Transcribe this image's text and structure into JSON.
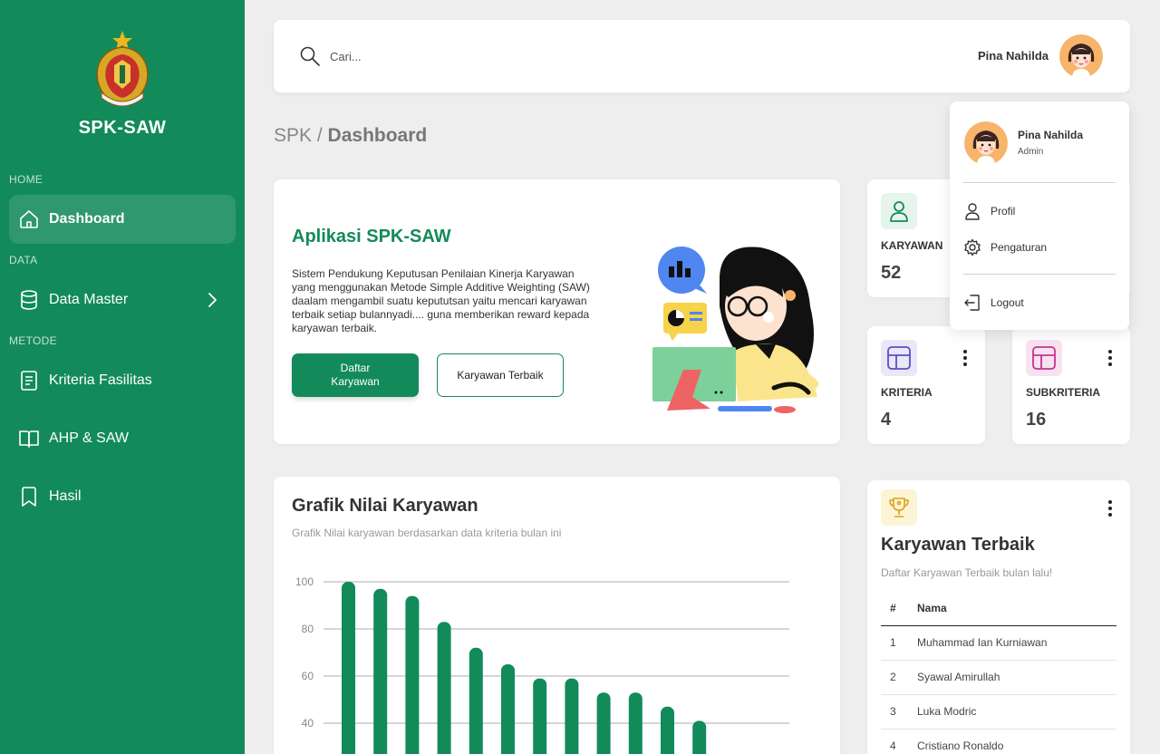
{
  "sidebar": {
    "app_name": "SPK-SAW",
    "sections": {
      "home": "HOME",
      "data": "DATA",
      "metode": "METODE"
    },
    "items": {
      "dashboard": "Dashboard",
      "data_master": "Data Master",
      "kriteria": "Kriteria Fasilitas",
      "ahp_saw": "AHP & SAW",
      "hasil": "Hasil"
    }
  },
  "search": {
    "placeholder": "Cari..."
  },
  "user": {
    "name": "Pina Nahilda",
    "role": "Admin"
  },
  "breadcrumb": {
    "root": "SPK",
    "separator": " / ",
    "current": "Dashboard"
  },
  "hero": {
    "title": "Aplikasi SPK-SAW",
    "description": "Sistem Pendukung Keputusan Penilaian Kinerja Karyawan yang menggunakan Metode Simple Additive Weighting (SAW) daalam mengambil suatu kepututsan  yaitu mencari karyawan terbaik setiap bulannyadi.... guna memberikan reward kepada karyawan terbaik.",
    "btn_primary": "Daftar Karyawan",
    "btn_secondary": "Karyawan Terbaik"
  },
  "stats": {
    "karyawan": {
      "label": "KARYAWAN",
      "value": "52"
    },
    "kriteria": {
      "label": "KRITERIA",
      "value": "4"
    },
    "subkriteria": {
      "label": "SUBKRITERIA",
      "value": "16"
    }
  },
  "dropdown": {
    "profil": "Profil",
    "pengaturan": "Pengaturan",
    "logout": "Logout"
  },
  "chart": {
    "title": "Grafik Nilai Karyawan",
    "subtitle": "Grafik Nilai karyawan berdasarkan data kriteria bulan ini"
  },
  "chart_data": {
    "type": "bar",
    "values": [
      100,
      97,
      94,
      83,
      72,
      65,
      59,
      59,
      53,
      53,
      47,
      41
    ],
    "yticks": [
      100,
      80,
      60,
      40
    ],
    "color": "#138a5a",
    "grid": true
  },
  "best": {
    "title": "Karyawan Terbaik",
    "subtitle": "Daftar Karyawan Terbaik bulan lalu!",
    "headers": {
      "no": "#",
      "name": "Nama"
    },
    "rows": [
      {
        "no": "1",
        "name": "Muhammad Ian Kurniawan"
      },
      {
        "no": "2",
        "name": "Syawal Amirullah"
      },
      {
        "no": "3",
        "name": "Luka Modric"
      },
      {
        "no": "4",
        "name": "Cristiano Ronaldo"
      }
    ]
  },
  "colors": {
    "primary": "#138a5a",
    "background": "#eeeeee",
    "kriteria_icon": "#5b4fc4",
    "subkriteria_icon": "#c2368f",
    "trophy": "#d8a31a"
  }
}
